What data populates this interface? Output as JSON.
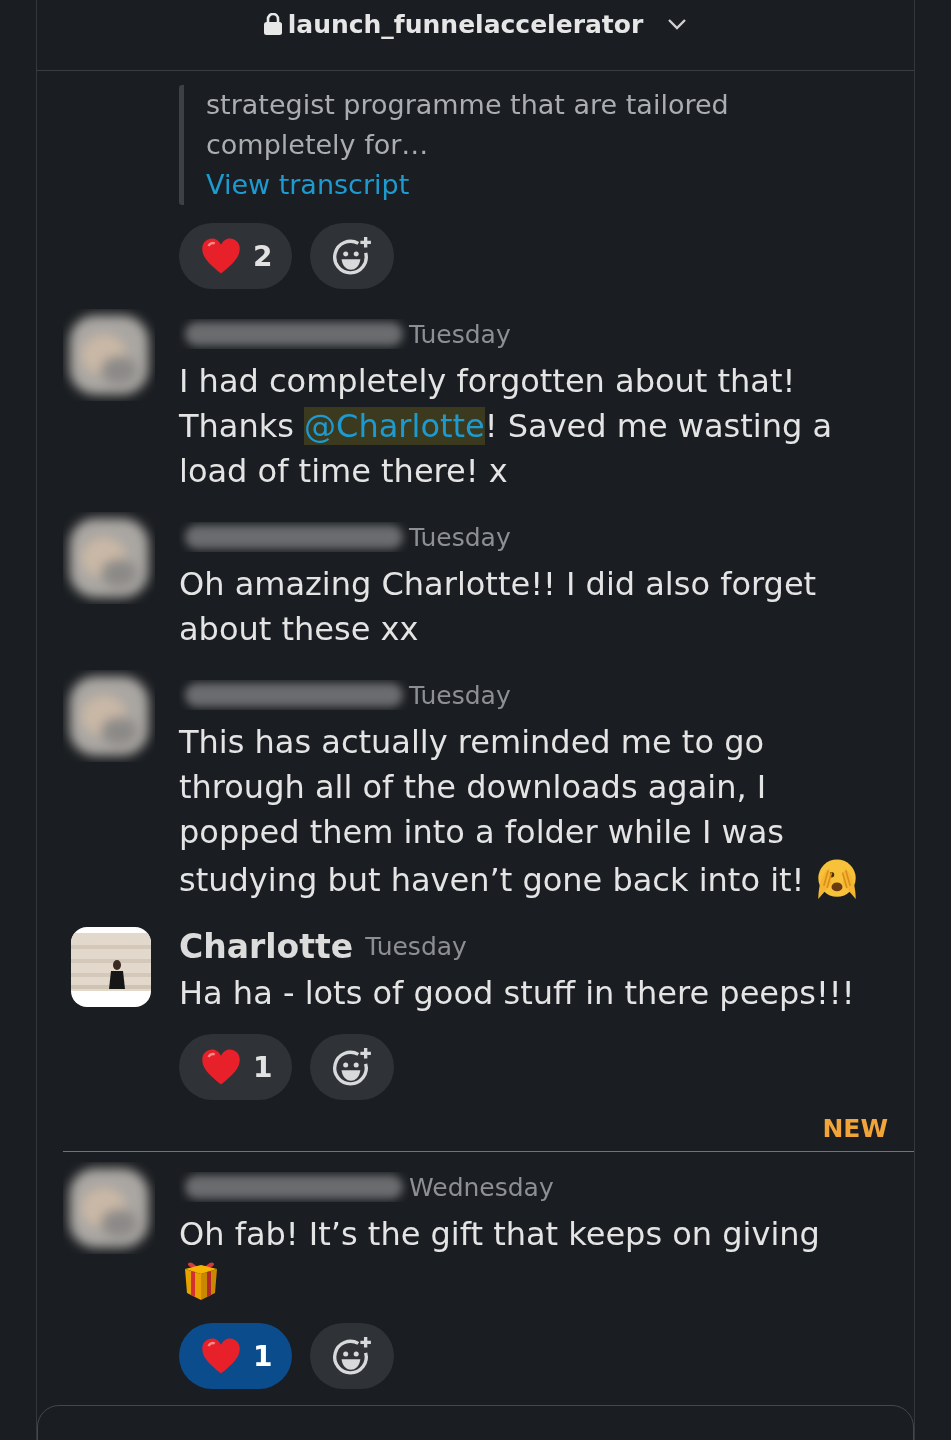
{
  "header": {
    "title": "launch_funnelaccelerator"
  },
  "feed": [
    {
      "kind": "quote",
      "text": "strategist programme that are tailored completely for…",
      "link": "View transcript",
      "reactions": [
        {
          "count": "2",
          "selected": false
        }
      ]
    },
    {
      "kind": "message",
      "avatar": {
        "kind": "picture",
        "blurred": true
      },
      "time": "Tuesday",
      "parts": [
        {
          "kind": "text",
          "text": "I had completely forgotten about that! Thanks "
        },
        {
          "kind": "mention",
          "text": "@Charlotte"
        },
        {
          "kind": "text",
          "text": "! Saved me wasting a load of time there! x"
        }
      ]
    },
    {
      "kind": "message",
      "avatar": {
        "kind": "picture",
        "blurred": true
      },
      "time": "Tuesday",
      "parts": [
        {
          "kind": "text",
          "text": "Oh amazing Charlotte!! I did also forget about these xx"
        }
      ]
    },
    {
      "kind": "message",
      "avatar": {
        "kind": "picture",
        "blurred": true
      },
      "time": "Tuesday",
      "parts": [
        {
          "kind": "text",
          "text": "This has actually reminded me to go through all of the downloads again, I popped them into a folder while I was studying but haven’t gone back into it! "
        },
        {
          "kind": "peek"
        }
      ]
    },
    {
      "kind": "message",
      "avatar": {
        "kind": "picture",
        "blurred": false
      },
      "author": "Charlotte",
      "time": "Tuesday",
      "parts": [
        {
          "kind": "text",
          "text": "Ha ha - lots of good stuff in there peeps!!!"
        }
      ],
      "reactions": [
        {
          "count": "1",
          "selected": false
        }
      ]
    },
    {
      "kind": "divider",
      "label": "NEW"
    },
    {
      "kind": "message",
      "avatar": {
        "kind": "picture",
        "blurred": true
      },
      "time": "Wednesday",
      "parts": [
        {
          "kind": "text",
          "text": "Oh fab! It’s the gift that keeps on giving "
        },
        {
          "kind": "gift"
        }
      ],
      "reactions": [
        {
          "count": "1",
          "selected": true
        }
      ]
    }
  ]
}
